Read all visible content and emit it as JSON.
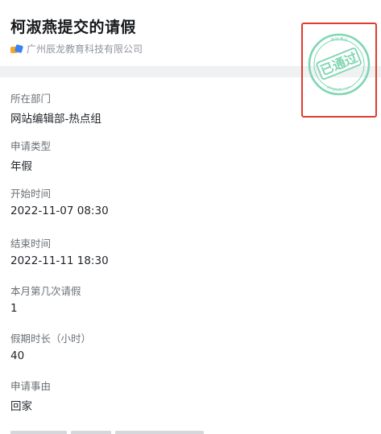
{
  "header": {
    "title": "柯淑燕提交的请假",
    "org": "广州辰龙教育科技有限公司"
  },
  "fields": [
    {
      "label": "所在部门",
      "value": "网站编辑部-热点组"
    },
    {
      "label": "申请类型",
      "value": "年假"
    },
    {
      "label": "开始时间",
      "value": "2022-11-07 08:30"
    },
    {
      "label": "结束时间",
      "value": "2022-11-11 18:30"
    },
    {
      "label": "本月第几次请假",
      "value": "1"
    },
    {
      "label": "假期时长（小时）",
      "value": "40"
    },
    {
      "label": "申请事由",
      "value": "回家"
    }
  ],
  "stamp": {
    "text": "已通过",
    "top_text": "审批通过",
    "bottom_text": "dingtalk.com",
    "color": "#7fd6b2"
  },
  "colors": {
    "highlight_border": "#e03b2f",
    "band": "#f0f1f3"
  }
}
